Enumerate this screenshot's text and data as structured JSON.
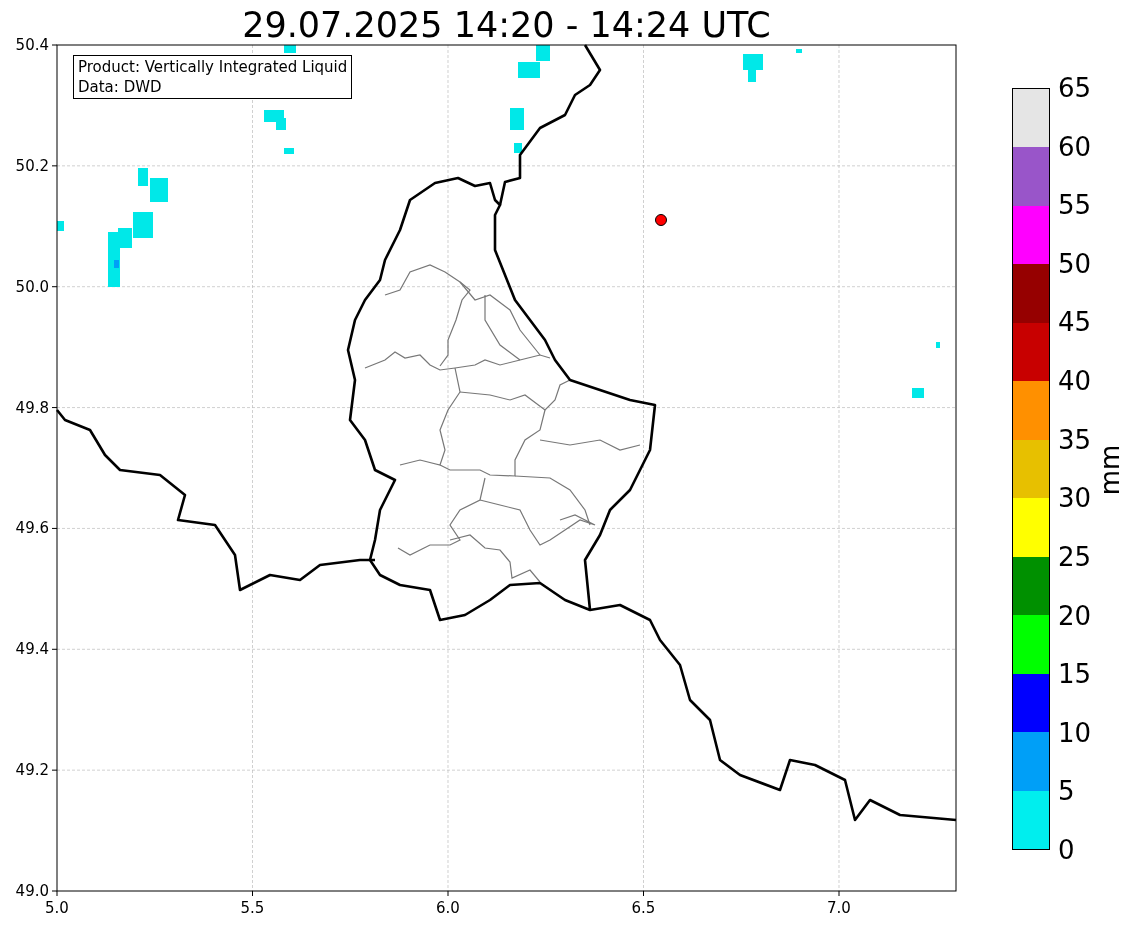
{
  "title": "29.07.2025 14:20 - 14:24 UTC",
  "legend": {
    "lines": [
      "Product: Vertically Integrated Liquid",
      "Data: DWD"
    ]
  },
  "x_ticks": [
    "5.0",
    "5.5",
    "6.0",
    "6.5",
    "7.0"
  ],
  "y_ticks": [
    "50.4",
    "50.2",
    "50.0",
    "49.8",
    "49.6",
    "49.4",
    "49.2",
    "49.0"
  ],
  "colorbar": {
    "label": "mm",
    "ticks": [
      "65",
      "60",
      "55",
      "50",
      "45",
      "40",
      "35",
      "30",
      "25",
      "20",
      "15",
      "10",
      "5",
      "0"
    ],
    "bands": [
      {
        "color": "#e5e5e5"
      },
      {
        "color": "#9955c9"
      },
      {
        "color": "#ff00ff"
      },
      {
        "color": "#960000"
      },
      {
        "color": "#c80000"
      },
      {
        "color": "#ff9000"
      },
      {
        "color": "#e7c000"
      },
      {
        "color": "#ffff00"
      },
      {
        "color": "#009000"
      },
      {
        "color": "#00ff00"
      },
      {
        "color": "#0000ff"
      },
      {
        "color": "#009ff7"
      },
      {
        "color": "#00eeee"
      }
    ]
  }
}
